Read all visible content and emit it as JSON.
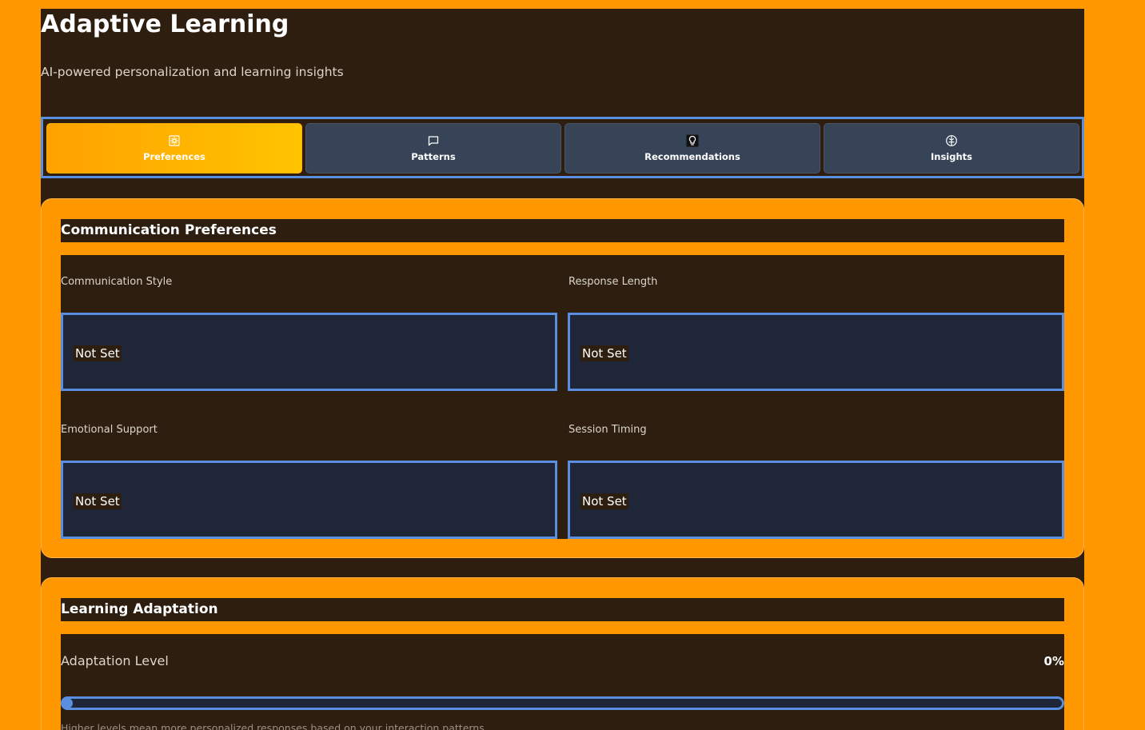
{
  "header": {
    "title": "Adaptive Learning",
    "subtitle": "AI-powered personalization and learning insights"
  },
  "tabs": [
    {
      "label": "Preferences",
      "icon": "gear-icon",
      "active": true
    },
    {
      "label": "Patterns",
      "icon": "message-square-icon",
      "active": false
    },
    {
      "label": "Recommendations",
      "icon": "lightbulb-icon",
      "active": false
    },
    {
      "label": "Insights",
      "icon": "brain-icon",
      "active": false
    }
  ],
  "communication": {
    "title": "Communication Preferences",
    "fields": [
      {
        "label": "Communication Style",
        "value": "Not Set"
      },
      {
        "label": "Response Length",
        "value": "Not Set"
      },
      {
        "label": "Emotional Support",
        "value": "Not Set"
      },
      {
        "label": "Session Timing",
        "value": "Not Set"
      }
    ]
  },
  "learning": {
    "title": "Learning Adaptation",
    "adaptation_label": "Adaptation Level",
    "adaptation_value": "0%",
    "adaptation_level": 0,
    "hint": "Higher levels mean more personalized responses based on your interaction patterns"
  },
  "colors": {
    "background": "#ff9800",
    "panel": "#2d1e10",
    "accent_blue": "#5a8ee0",
    "tab_inactive": "#374357",
    "select_bg": "#1f2638",
    "active_tab_gradient": [
      "#ffa200",
      "#ffc400"
    ]
  }
}
